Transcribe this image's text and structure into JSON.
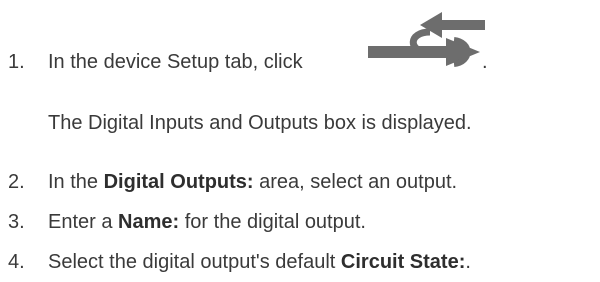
{
  "steps": [
    {
      "number": "1.",
      "before": "In the device Setup tab, click",
      "after": ".",
      "icon": "digital-io-arrows-icon"
    },
    {
      "number": "2.",
      "before": "In the ",
      "bold": "Digital Outputs:",
      "after": " area, select an output."
    },
    {
      "number": "3.",
      "before": "Enter a ",
      "bold": "Name:",
      "after": " for the digital output."
    },
    {
      "number": "4.",
      "before": "Select the digital output's default ",
      "bold": "Circuit State:",
      "after": "."
    }
  ],
  "step1_result": "The Digital Inputs and Outputs box is displayed.",
  "colors": {
    "text": "#3a3a3a",
    "icon": "#6d6d6d"
  }
}
